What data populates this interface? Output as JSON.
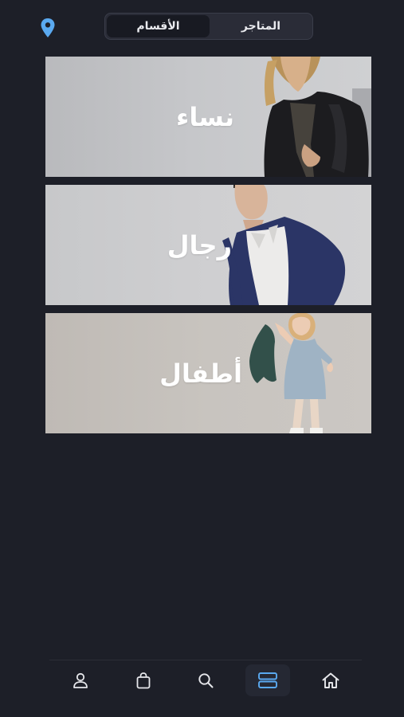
{
  "header": {
    "tabs": [
      {
        "label": "الأقسام",
        "active": true
      },
      {
        "label": "المتاجر",
        "active": false
      }
    ],
    "location_icon": "map-pin-icon",
    "accent_color": "#5aa9f0"
  },
  "categories": [
    {
      "label": "نساء"
    },
    {
      "label": "رجال"
    },
    {
      "label": "أطفال"
    }
  ],
  "bottom_nav": {
    "items": [
      {
        "icon": "user-icon",
        "active": false
      },
      {
        "icon": "shopping-bag-icon",
        "active": false
      },
      {
        "icon": "search-icon",
        "active": false
      },
      {
        "icon": "categories-icon",
        "active": true
      },
      {
        "icon": "home-icon",
        "active": false
      }
    ]
  },
  "colors": {
    "background": "#1d1f28",
    "active_icon": "#5aa9f0",
    "inactive_icon": "#e6e7eb"
  }
}
